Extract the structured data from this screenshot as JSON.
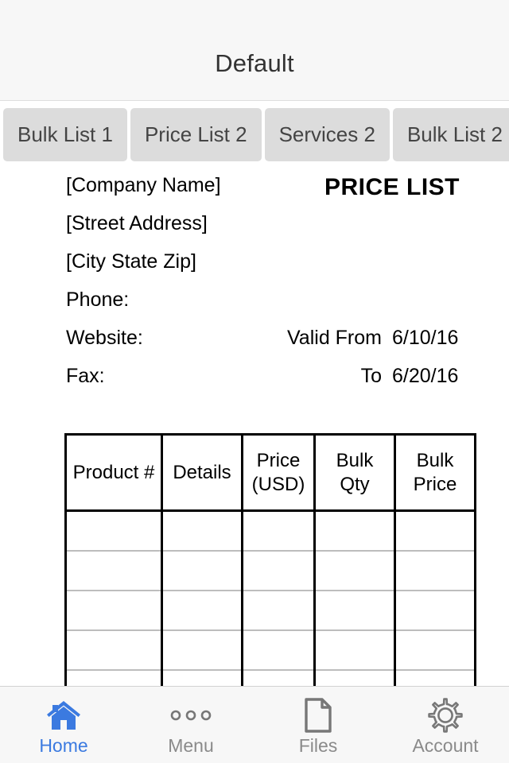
{
  "header": {
    "title": "Default"
  },
  "tabs": {
    "items": [
      {
        "label": "Bulk List 1"
      },
      {
        "label": "Price List 2"
      },
      {
        "label": "Services 2"
      },
      {
        "label": "Bulk List 2"
      }
    ]
  },
  "document": {
    "heading": "PRICE LIST",
    "info_lines": [
      {
        "text": "[Company Name]"
      },
      {
        "text": "[Street Address]"
      },
      {
        "text": "[City State Zip]"
      },
      {
        "text": "Phone:"
      },
      {
        "text": "Website:"
      },
      {
        "text": "Fax:"
      }
    ],
    "validity": [
      {
        "label": "Valid From",
        "value": "6/10/16"
      },
      {
        "label": "To",
        "value": "6/20/16"
      }
    ],
    "table": {
      "columns": [
        {
          "line1": "Product #",
          "line2": ""
        },
        {
          "line1": "Details",
          "line2": ""
        },
        {
          "line1": "Price",
          "line2": "(USD)"
        },
        {
          "line1": "Bulk",
          "line2": "Qty"
        },
        {
          "line1": "Bulk",
          "line2": "Price"
        }
      ],
      "rows": [
        [
          "",
          "",
          "",
          "",
          ""
        ],
        [
          "",
          "",
          "",
          "",
          ""
        ],
        [
          "",
          "",
          "",
          "",
          ""
        ],
        [
          "",
          "",
          "",
          "",
          ""
        ],
        [
          "",
          "",
          "",
          "",
          ""
        ]
      ]
    }
  },
  "tabbar": {
    "items": [
      {
        "label": "Home",
        "icon": "home-icon",
        "active": true
      },
      {
        "label": "Menu",
        "icon": "dots-icon",
        "active": false
      },
      {
        "label": "Files",
        "icon": "document-icon",
        "active": false
      },
      {
        "label": "Account",
        "icon": "gear-icon",
        "active": false
      }
    ]
  },
  "colors": {
    "accent": "#3b7ae0",
    "inactive": "#8a8a8a",
    "chrome": "#f7f7f7",
    "tab_chip": "#dcdcdc"
  }
}
